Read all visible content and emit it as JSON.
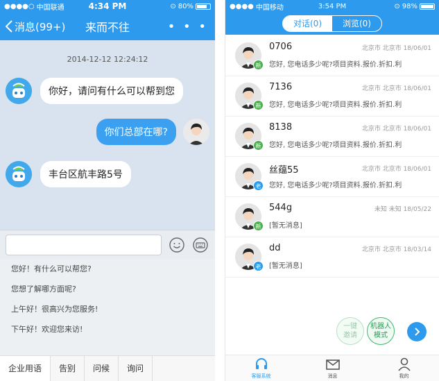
{
  "left": {
    "status": {
      "carrier": "中国联通",
      "time": "4:34 PM",
      "battery": "80%"
    },
    "nav": {
      "back_label": "消息(99+)",
      "title": "来而不往",
      "more": "• • •"
    },
    "timestamp": "2014-12-12  12:24:12",
    "messages": [
      {
        "from": "robot",
        "text": "你好，请问有什么可以帮到您"
      },
      {
        "from": "me",
        "text": "你们总部在哪?"
      },
      {
        "from": "robot",
        "text": "丰台区航丰路5号"
      }
    ],
    "phrases": [
      "您好！有什么可以帮您?",
      "您想了解哪方面呢?",
      "上午好！很高兴为您服务!",
      "下午好！欢迎您来访!"
    ],
    "tabs": [
      "企业用语",
      "告别",
      "问候",
      "询问"
    ]
  },
  "right": {
    "status": {
      "carrier": "中国移动",
      "time": "3:54 PM",
      "battery": "98%"
    },
    "segments": [
      "对话(0)",
      "浏览(0)"
    ],
    "rows": [
      {
        "name": "0706",
        "meta": "北京市 北京市 18/06/01",
        "preview": "您好, 您电话多少呢?项目资料.报价.折扣.利",
        "tag": "新"
      },
      {
        "name": "7136",
        "meta": "北京市 北京市 18/06/01",
        "preview": "您好, 您电话多少呢?项目资料.报价.折扣.利",
        "tag": "新"
      },
      {
        "name": "8138",
        "meta": "北京市 北京市 18/06/01",
        "preview": "您好, 您电话多少呢?项目资料.报价.折扣.利",
        "tag": "新"
      },
      {
        "name": "丝蕴55",
        "meta": "北京市 北京市 18/06/01",
        "preview": "您好, 您电话多少呢?项目资料.报价.折扣.利",
        "tag": "老"
      },
      {
        "name": "544g",
        "meta": "未知 未知 18/05/22",
        "preview": "[暂无消息]",
        "tag": "新"
      },
      {
        "name": "dd",
        "meta": "北京市 北京市 18/03/14",
        "preview": "[暂无消息]",
        "tag": "老"
      }
    ],
    "float": {
      "invite": "一键\n邀请",
      "robot": "机器人\n模式"
    },
    "bottom_nav": [
      "客服系统",
      "消息",
      "我的"
    ]
  }
}
